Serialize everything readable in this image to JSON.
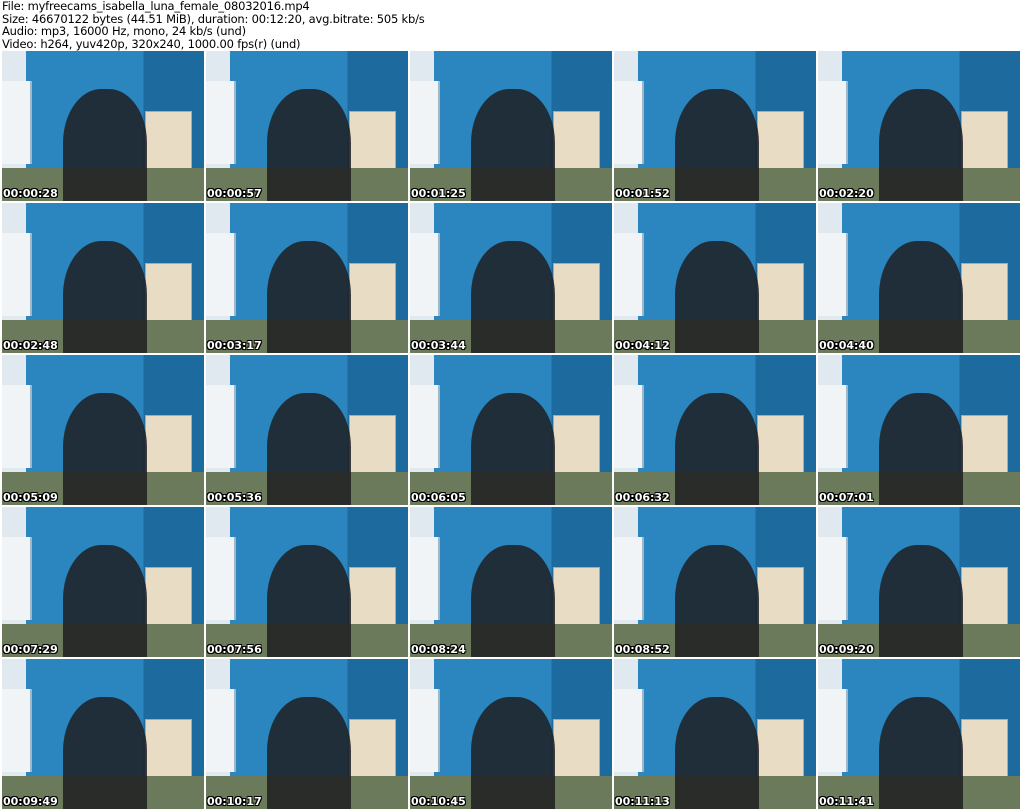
{
  "header": {
    "file": "File: myfreecams_isabella_luna_female_08032016.mp4",
    "size": "Size: 46670122 bytes (44.51 MiB), duration: 00:12:20, avg.bitrate: 505 kb/s",
    "audio": "Audio: mp3, 16000 Hz, mono, 24 kb/s (und)",
    "video": "Video: h264, yuv420p, 320x240, 1000.00 fps(r) (und)"
  },
  "thumbnails": [
    "00:00:28",
    "00:00:57",
    "00:01:25",
    "00:01:52",
    "00:02:20",
    "00:02:48",
    "00:03:17",
    "00:03:44",
    "00:04:12",
    "00:04:40",
    "00:05:09",
    "00:05:36",
    "00:06:05",
    "00:06:32",
    "00:07:01",
    "00:07:29",
    "00:07:56",
    "00:08:24",
    "00:08:52",
    "00:09:20",
    "00:09:49",
    "00:10:17",
    "00:10:45",
    "00:11:13",
    "00:11:41"
  ]
}
